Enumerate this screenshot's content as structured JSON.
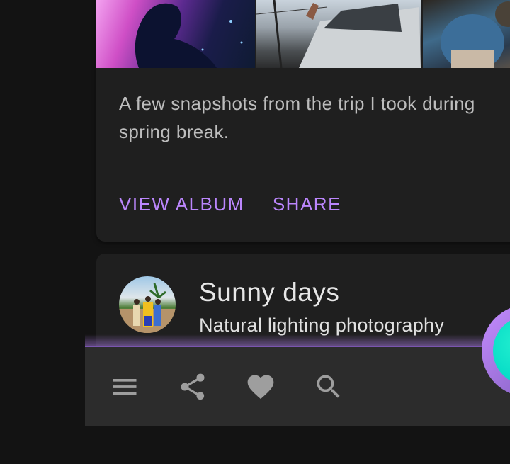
{
  "album_card": {
    "description": "A few snapshots from the trip I took during\nspring break.",
    "actions": {
      "view_album": "VIEW ALBUM",
      "share": "SHARE"
    },
    "accent_color": "#bb86fc"
  },
  "item_card": {
    "title": "Sunny days",
    "subtitle": "Natural lighting photography"
  },
  "bottom_bar": {
    "icons": [
      "menu-icon",
      "share-icon",
      "favorite-icon",
      "search-icon"
    ],
    "fab_color": "#03dac6"
  }
}
